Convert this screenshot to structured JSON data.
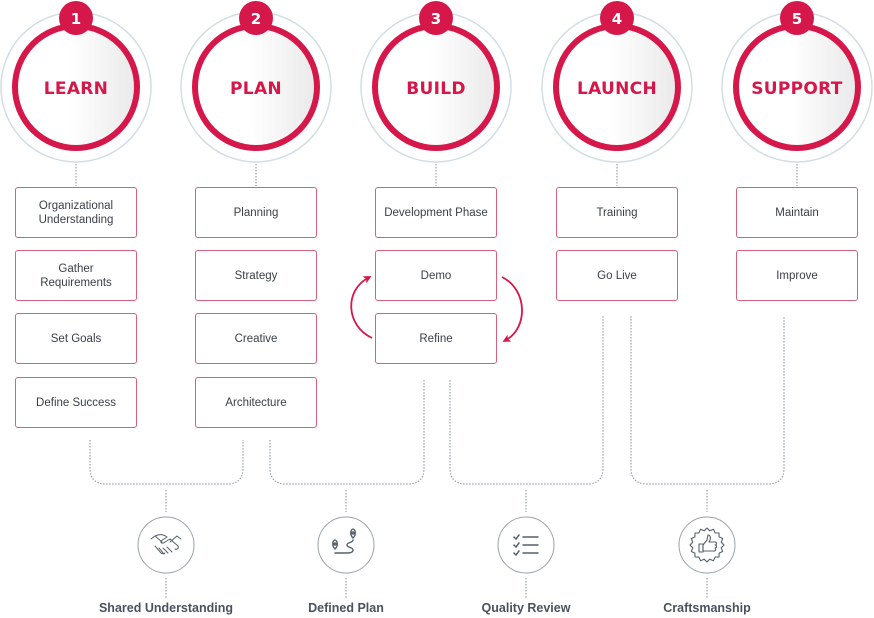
{
  "colors": {
    "accent": "#d6174a",
    "box_border": "#d9607a",
    "outer_ring": "#d3dde5",
    "connector": "#9aa3ad",
    "icon": "#55606c",
    "label": "#4a5260"
  },
  "stages": [
    {
      "number": "1",
      "title": "LEARN",
      "tasks": [
        "Organizational Understanding",
        "Gather Requirements",
        "Set Goals",
        "Define Success"
      ]
    },
    {
      "number": "2",
      "title": "PLAN",
      "tasks": [
        "Planning",
        "Strategy",
        "Creative",
        "Architecture"
      ]
    },
    {
      "number": "3",
      "title": "BUILD",
      "tasks": [
        "Development Phase",
        "Demo",
        "Refine"
      ]
    },
    {
      "number": "4",
      "title": "LAUNCH",
      "tasks": [
        "Training",
        "Go Live"
      ]
    },
    {
      "number": "5",
      "title": "SUPPORT",
      "tasks": [
        "Maintain",
        "Improve"
      ]
    }
  ],
  "build_loop": {
    "from": "Demo",
    "to": "Refine",
    "cycle": true
  },
  "outcomes": [
    {
      "label": "Shared Understanding",
      "icon": "handshake-icon",
      "connects": [
        "LEARN",
        "PLAN"
      ]
    },
    {
      "label": "Defined Plan",
      "icon": "route-map-pin-icon",
      "connects": [
        "PLAN",
        "BUILD"
      ]
    },
    {
      "label": "Quality Review",
      "icon": "checklist-icon",
      "connects": [
        "BUILD",
        "LAUNCH"
      ]
    },
    {
      "label": "Craftsmanship",
      "icon": "thumbs-up-badge-icon",
      "connects": [
        "LAUNCH",
        "SUPPORT"
      ]
    }
  ]
}
